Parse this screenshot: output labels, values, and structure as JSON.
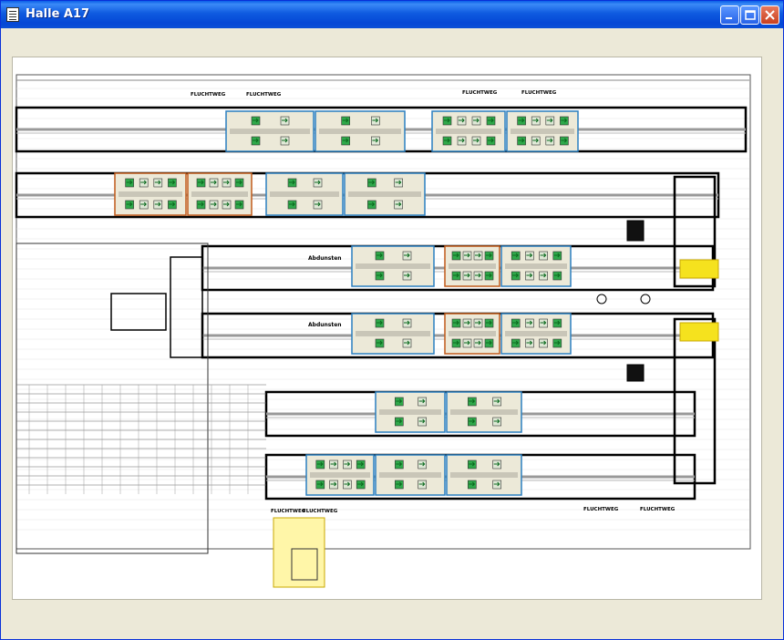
{
  "window": {
    "title": "Halle A17"
  },
  "plan": {
    "labels": {
      "fluchtweg": "FLUCHTWEG",
      "abdunsten": "Abdunsten"
    }
  },
  "colors": {
    "accent_highlight": "#f5e21e",
    "station_border": "#2a7fc0",
    "station_border_alt": "#c05a1a",
    "station_fill": "#ece9d8"
  }
}
